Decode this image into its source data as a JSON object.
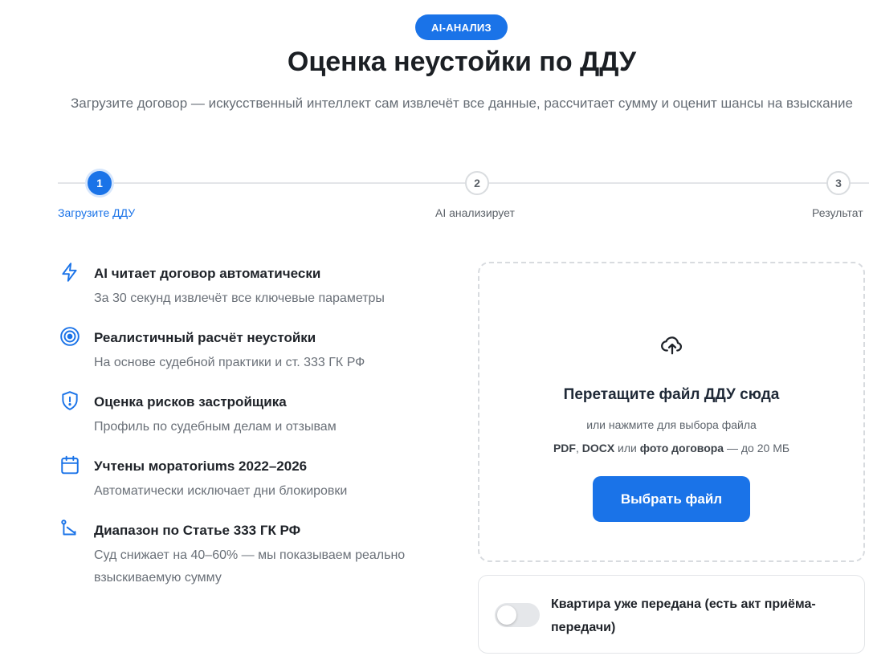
{
  "header": {
    "badge": "AI-АНАЛИЗ",
    "title": "Оценка неустойки по ДДУ",
    "subtitle": "Загрузите договор — искусственный интеллект сам извлечёт все данные, рассчитает сумму и оценит шансы на взыскание"
  },
  "stepper": {
    "steps": [
      {
        "number": "1",
        "label": "Загрузите ДДУ",
        "state": "active"
      },
      {
        "number": "2",
        "label": "AI анализирует",
        "state": "pending"
      },
      {
        "number": "3",
        "label": "Результат",
        "state": "pending"
      }
    ]
  },
  "features": [
    {
      "icon": "lightning-icon",
      "title": "AI читает договор автоматически",
      "description": "За 30 секунд извлечёт все ключевые параметры"
    },
    {
      "icon": "target-icon",
      "title": "Реалистичный расчёт неустойки",
      "description": "На основе судебной практики и ст. 333 ГК РФ"
    },
    {
      "icon": "shield-alert-icon",
      "title": "Оценка рисков застройщика",
      "description": "Профиль по судебным делам и отзывам"
    },
    {
      "icon": "calendar-icon",
      "title": "Учтены моратoriums 2022–2026",
      "description": "Автоматически исключает дни блокировки"
    },
    {
      "icon": "range-icon",
      "title": "Диапазон по Статье 333 ГК РФ",
      "description": "Суд снижает на 40–60% — мы показываем реально взыскиваемую сумму"
    }
  ],
  "upload": {
    "icon": "cloud-upload-icon",
    "title": "Перетащите файл ДДУ сюда",
    "hint": "или нажмите для выбора файла",
    "formats": {
      "fmt1": "PDF",
      "sep1": ", ",
      "fmt2": "DOCX",
      "sep2": " или ",
      "fmt3": "фото договора",
      "limit": " — до 20 МБ"
    },
    "button_label": "Выбрать файл"
  },
  "handover": {
    "label": "Квартира уже передана (есть акт приёма-передачи)",
    "enabled": false
  },
  "colors": {
    "accent": "#1a73e8",
    "text": "#1f2329",
    "muted": "#6a7078"
  }
}
